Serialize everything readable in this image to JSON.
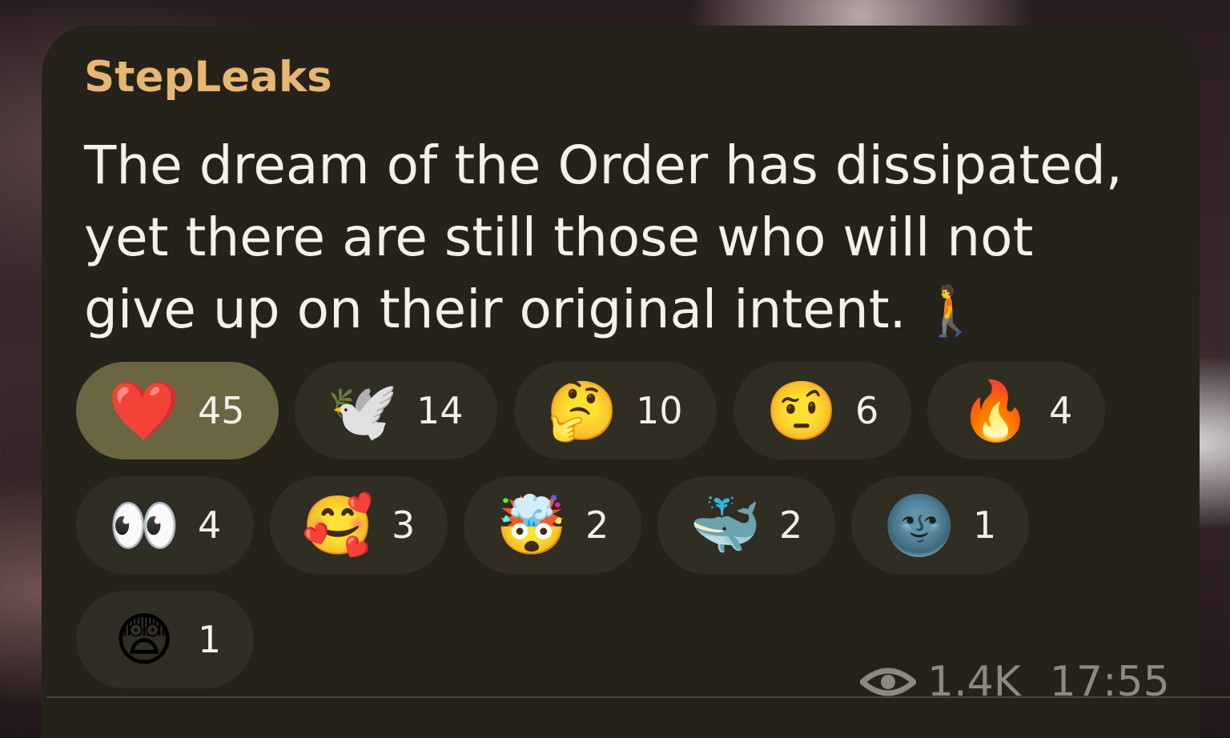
{
  "post": {
    "author": "StepLeaks",
    "text": "The dream of the Order has dissipated, yet there are still those who will not give up on their original intent.",
    "text_emoji": "🚶"
  },
  "reactions": [
    {
      "emoji": "❤️",
      "icon": "red-heart-icon",
      "count": "45",
      "active": true
    },
    {
      "emoji": "🕊️",
      "icon": "dove-icon",
      "count": "14",
      "active": false
    },
    {
      "emoji": "🤔",
      "icon": "thinking-face-icon",
      "count": "10",
      "active": false
    },
    {
      "emoji": "🤨",
      "icon": "raised-eyebrow-face-icon",
      "count": "6",
      "active": false
    },
    {
      "emoji": "🔥",
      "icon": "fire-icon",
      "count": "4",
      "active": false
    },
    {
      "emoji": "👀",
      "icon": "eyes-icon",
      "count": "4",
      "active": false
    },
    {
      "emoji": "🥰",
      "icon": "smiling-face-with-hearts-icon",
      "count": "3",
      "active": false
    },
    {
      "emoji": "🤯",
      "icon": "exploding-head-icon",
      "count": "2",
      "active": false
    },
    {
      "emoji": "🐳",
      "icon": "spouting-whale-icon",
      "count": "2",
      "active": false
    },
    {
      "emoji": "🌚",
      "icon": "new-moon-face-icon",
      "count": "1",
      "active": false
    },
    {
      "emoji": "😨",
      "icon": "fearful-face-icon",
      "count": "1",
      "active": false
    }
  ],
  "meta": {
    "views": "1.4K",
    "time": "17:55",
    "views_icon": "eye-icon"
  },
  "colors": {
    "bubble": "#24221a",
    "author": "#e6b672",
    "pill": "#302d22",
    "pill_active": "#6c6542",
    "meta": "#8d8a7d"
  }
}
